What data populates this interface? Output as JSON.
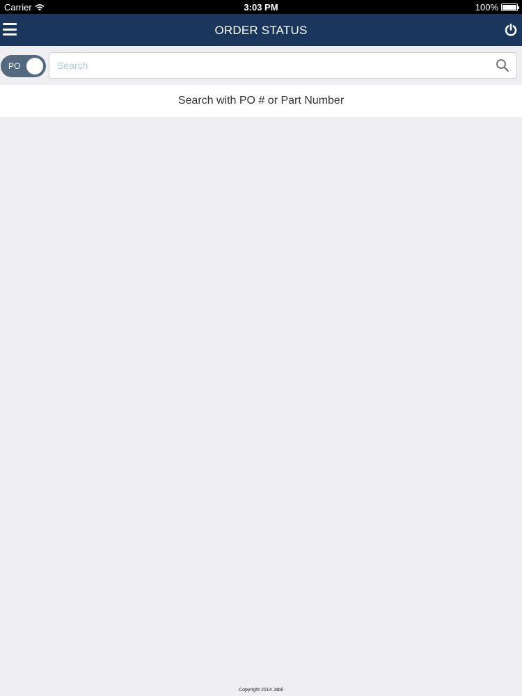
{
  "status_bar": {
    "carrier": "Carrier",
    "time": "3:03 PM",
    "battery": "100%",
    "icons": [
      "wifi-icon",
      "battery-icon"
    ]
  },
  "nav": {
    "title": "ORDER STATUS",
    "left_icon": "menu-icon",
    "right_icon": "power-icon",
    "background_color": "#1a365d"
  },
  "search": {
    "toggle_label": "PO",
    "placeholder": "Search",
    "value": "",
    "icon": "search-icon",
    "toggle_color": "#52697f"
  },
  "hint": {
    "text": "Search with PO # or Part Number"
  },
  "footer": {
    "copyright": "Copyright 2014 Jabil"
  }
}
